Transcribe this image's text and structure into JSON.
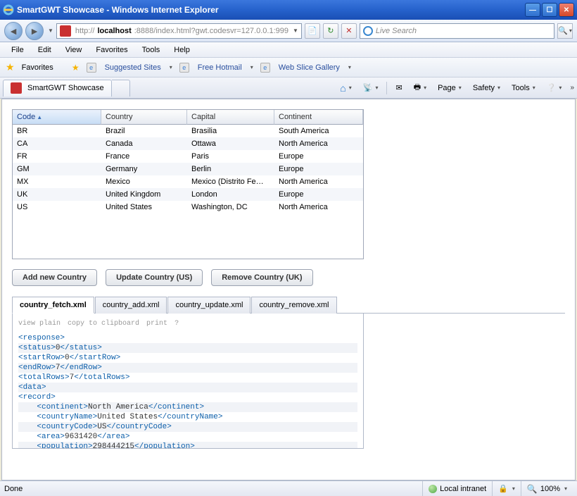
{
  "window": {
    "title": "SmartGWT Showcase - Windows Internet Explorer"
  },
  "nav": {
    "proto": "http://",
    "host": "localhost",
    "rest": ":8888/index.html?gwt.codesvr=127.0.0.1:999",
    "search_placeholder": "Live Search"
  },
  "menu": {
    "items": [
      "File",
      "Edit",
      "View",
      "Favorites",
      "Tools",
      "Help"
    ]
  },
  "favbar": {
    "label": "Favorites",
    "links": [
      "Suggested Sites",
      "Free Hotmail",
      "Web Slice Gallery"
    ]
  },
  "tab": {
    "title": "SmartGWT Showcase"
  },
  "cmdbar": {
    "items": [
      "Page",
      "Safety",
      "Tools"
    ]
  },
  "grid": {
    "columns": [
      "Code",
      "Country",
      "Capital",
      "Continent"
    ],
    "sort_col": 0,
    "rows": [
      [
        "BR",
        "Brazil",
        "Brasilia",
        "South America"
      ],
      [
        "CA",
        "Canada",
        "Ottawa",
        "North America"
      ],
      [
        "FR",
        "France",
        "Paris",
        "Europe"
      ],
      [
        "GM",
        "Germany",
        "Berlin",
        "Europe"
      ],
      [
        "MX",
        "Mexico",
        "Mexico (Distrito Fe…",
        "North America"
      ],
      [
        "UK",
        "United Kingdom",
        "London",
        "Europe"
      ],
      [
        "US",
        "United States",
        "Washington, DC",
        "North America"
      ]
    ]
  },
  "buttons": {
    "add": "Add new Country",
    "update": "Update Country (US)",
    "remove": "Remove Country (UK)"
  },
  "srctabs": [
    "country_fetch.xml",
    "country_add.xml",
    "country_update.xml",
    "country_remove.xml"
  ],
  "src_toolbar": [
    "view plain",
    "copy to clipboard",
    "print",
    "?"
  ],
  "src_lines": [
    {
      "t": "<response>",
      "txt": ""
    },
    {
      "t": "<status>",
      "mid": "0",
      "c": "</status>"
    },
    {
      "t": "<startRow>",
      "mid": "0",
      "c": "</startRow>"
    },
    {
      "t": "<endRow>",
      "mid": "7",
      "c": "</endRow>"
    },
    {
      "t": "<totalRows>",
      "mid": "7",
      "c": "</totalRows>"
    },
    {
      "t": "<data>",
      "txt": ""
    },
    {
      "t": "<record>",
      "txt": ""
    },
    {
      "indent": 1,
      "t": "<continent>",
      "mid": "North America",
      "c": "</continent>"
    },
    {
      "indent": 1,
      "t": "<countryName>",
      "mid": "United States",
      "c": "</countryName>"
    },
    {
      "indent": 1,
      "t": "<countryCode>",
      "mid": "US",
      "c": "</countryCode>"
    },
    {
      "indent": 1,
      "t": "<area>",
      "mid": "9631420",
      "c": "</area>"
    },
    {
      "indent": 1,
      "t": "<population>",
      "mid": "298444215",
      "c": "</population>"
    }
  ],
  "status": {
    "text": "Done",
    "zone": "Local intranet",
    "zoom": "100%"
  }
}
